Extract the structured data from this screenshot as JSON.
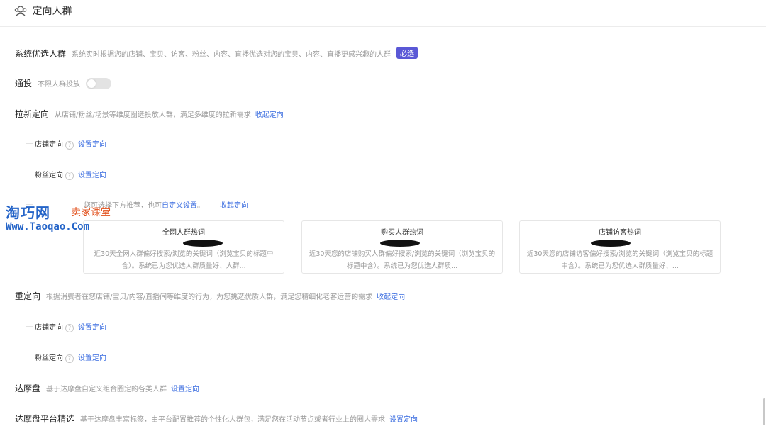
{
  "header": {
    "title": "定向人群",
    "icon": "crowd-icon"
  },
  "system": {
    "label": "系统优选人群",
    "desc": "系统实时根据您的店铺、宝贝、访客、粉丝、内容、直播优选对您的宝贝、内容、直播更感兴趣的人群",
    "badge": "必选"
  },
  "tongtou": {
    "label": "通投",
    "desc": "不限人群投放",
    "enabled": false
  },
  "laxin": {
    "label": "拉新定向",
    "desc": "从店铺/粉丝/场景等维度圈选投放人群，满足多维度的拉新需求",
    "collapse": "收起定向",
    "items": [
      {
        "label": "店铺定向",
        "action": "设置定向"
      },
      {
        "label": "粉丝定向",
        "action": "设置定向"
      }
    ],
    "keyword_row": {
      "desc": "您可选择下方推荐，也可",
      "link": "自定义设置",
      "punct": "。",
      "collapse": "收起定向"
    },
    "cards": [
      {
        "title": "全网人群热词",
        "desc": "近30天全网人群偏好搜索/浏览的关键词（浏览宝贝的标题中含）。系统已为您优选人群质量好、人群..."
      },
      {
        "title": "购买人群热词",
        "desc": "近30天您的店铺购买人群偏好搜索/浏览的关键词（浏览宝贝的标题中含）。系统已为您优选人群质..."
      },
      {
        "title": "店铺访客热词",
        "desc": "近30天您的店铺访客偏好搜索/浏览的关键词（浏览宝贝的标题中含）。系统已为您优选人群质量好、..."
      }
    ]
  },
  "retarget": {
    "label": "重定向",
    "desc": "根据消费者在您店铺/宝贝/内容/直播间等维度的行为，为您挑选优质人群，满足您精细化老客运营的需求",
    "collapse": "收起定向",
    "items": [
      {
        "label": "店铺定向",
        "action": "设置定向"
      },
      {
        "label": "粉丝定向",
        "action": "设置定向"
      }
    ]
  },
  "damopan": {
    "label": "达摩盘",
    "desc": "基于达摩盘自定义组合圈定的各类人群",
    "action": "设置定向"
  },
  "damopan_platform": {
    "label": "达摩盘平台精选",
    "desc": "基于达摩盘丰富标签，由平台配置推荐的个性化人群包，满足您在活动节点或者行业上的圈人需求",
    "action": "设置定向"
  },
  "watermark": {
    "site_cn": "淘巧网",
    "tagline": "卖家课堂",
    "url": "Www.Taoqao.Com"
  },
  "colors": {
    "link": "#3c6ee0",
    "badge": "#5a58d6",
    "watermark_blue": "#2464c8",
    "watermark_orange": "#e2521e"
  }
}
